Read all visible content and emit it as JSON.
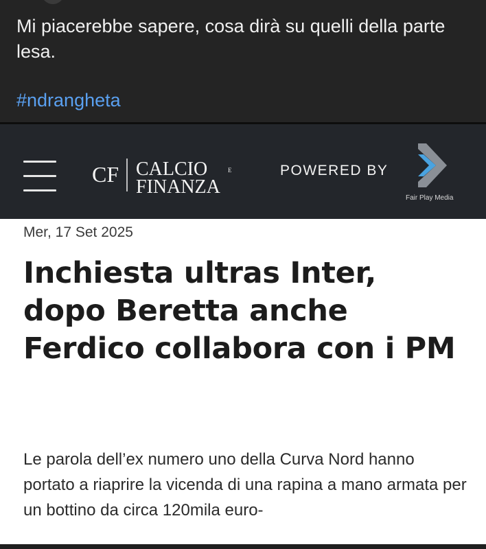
{
  "post": {
    "text": "Mi piacerebbe sapere, cosa dirà su quelli della parte lesa.",
    "hashtag": "#ndrangheta"
  },
  "header": {
    "logo_cf": "CF",
    "logo_calcio": "CALCIO",
    "logo_finanza": "FINANZA",
    "logo_e": "E",
    "powered_by": "POWERED BY",
    "partner": "Fair Play Media"
  },
  "article": {
    "date": "Mer, 17 Set 2025",
    "headline": "Inchiesta ultras Inter, dopo Beretta anche Ferdico collabora con i PM",
    "lede": "Le parola dell’ex numero uno della Curva Nord hanno portato a riaprire la vicenda di una rapina a mano armata per un bottino da circa 120mila euro-"
  },
  "colors": {
    "post_bg": "#242424",
    "hashtag": "#5aa0f0",
    "header_bg": "#23262b",
    "chevron_blue": "#4aa3e0",
    "chevron_gray": "#8a8f96"
  }
}
